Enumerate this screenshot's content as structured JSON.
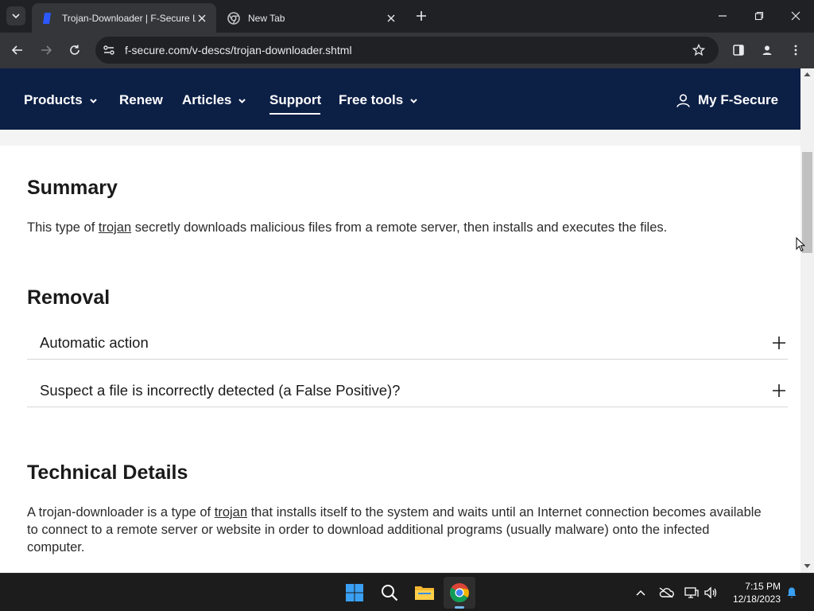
{
  "browser": {
    "tabs": [
      {
        "title": "Trojan-Downloader | F-Secure L",
        "active": true
      },
      {
        "title": "New Tab",
        "active": false
      }
    ],
    "url": "f-secure.com/v-descs/trojan-downloader.shtml"
  },
  "nav": {
    "items": [
      {
        "label": "Products",
        "has_dropdown": true
      },
      {
        "label": "Renew",
        "has_dropdown": false
      },
      {
        "label": "Articles",
        "has_dropdown": true
      },
      {
        "label": "Support",
        "has_dropdown": false,
        "active": true
      },
      {
        "label": "Free tools",
        "has_dropdown": true
      }
    ],
    "account_label": "My F-Secure"
  },
  "summary": {
    "heading": "Summary",
    "text_before": "This type of ",
    "link": "trojan",
    "text_after": " secretly downloads malicious files from a remote server, then installs and executes the files."
  },
  "removal": {
    "heading": "Removal",
    "items": [
      {
        "label": "Automatic action"
      },
      {
        "label": "Suspect a file is incorrectly detected (a False Positive)?"
      }
    ]
  },
  "technical": {
    "heading": "Technical Details",
    "text_before": "A trojan-downloader is a type of ",
    "link": "trojan",
    "text_after": " that installs itself to the system and waits until an Internet connection becomes available to connect to a remote server or website in order to download additional programs (usually malware) onto the infected computer."
  },
  "taskbar": {
    "time": "7:15 PM",
    "date": "12/18/2023"
  },
  "colors": {
    "nav_background": "#0c1f45",
    "browser_frame": "#202124",
    "toolbar": "#35363a"
  }
}
